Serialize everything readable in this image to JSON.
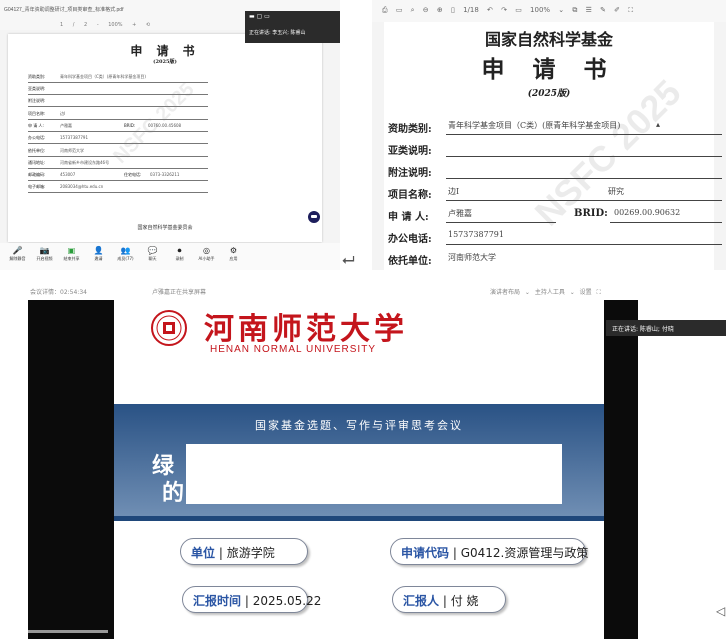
{
  "top_left": {
    "file_name": "G04127_青年资助调整研讨_项目类审查_标准格式.pdf",
    "toolbar_text": "1 / 2  - 100% +  ⟲",
    "doc_title": "申 请 书",
    "doc_year": "(2025版)",
    "rows": [
      {
        "label": "资助类别:",
        "value": "青年科学基金项目（C类）(原青年科学基金项目)"
      },
      {
        "label": "亚类说明:",
        "value": ""
      },
      {
        "label": "附注说明:",
        "value": ""
      },
      {
        "label": "项目名称:",
        "value": "边I"
      },
      {
        "label": "申 请 人:",
        "value": "卢雅嘉"
      },
      {
        "label": "办公电话:",
        "value": "15737387791"
      },
      {
        "label": "依托单位:",
        "value": "河南师范大学"
      },
      {
        "label": "通讯地址:",
        "value": "河南省新乡市建设东路46号"
      },
      {
        "label": "邮政编码:",
        "value": "453007"
      },
      {
        "label": "电子邮箱:",
        "value": "2083034@htu.edu.cn"
      }
    ],
    "brid_label": "BRID:",
    "brid_value": "00760.00.45608",
    "phone_label": "住宅电话:",
    "phone_value": "0373-3326211",
    "footer": "国家自然科学基金委员会",
    "watermark": "NSFC 2025",
    "speaking_label": "正在讲话: 李玉兴; 陈睿山",
    "bottom_items": [
      {
        "icon": "🎤",
        "label": "解除静音"
      },
      {
        "icon": "📷",
        "label": "开启视频"
      },
      {
        "icon": "▣",
        "label": "结束共享"
      },
      {
        "icon": "👤",
        "label": "邀请"
      },
      {
        "icon": "👥",
        "label": "成员(77)"
      },
      {
        "icon": "💬",
        "label": "聊天"
      },
      {
        "icon": "⏺",
        "label": "录制"
      },
      {
        "icon": "◎",
        "label": "AI小助手"
      },
      {
        "icon": "⚙",
        "label": "应用"
      }
    ]
  },
  "top_right": {
    "toolbar_text": "⎙ ▭ ⌕   ⊖ ⊕ ▯ 1/18 ↶ ↷ ▭ 100% ⌄ ⧉ ☰ ✎ ✐ ⛶",
    "title1": "国家自然科学基金",
    "title2": "申 请 书",
    "year": "(2025版)",
    "watermark": "NSFC 2025",
    "rows": [
      {
        "label": "资助类别:",
        "value": "青年科学基金项目（C类）(原青年科学基金项目)"
      },
      {
        "label": "亚类说明:",
        "value": ""
      },
      {
        "label": "附注说明:",
        "value": ""
      },
      {
        "label": "项目名称:",
        "value": "边I"
      },
      {
        "label": "申 请 人:",
        "value": "卢雅嘉"
      },
      {
        "label": "办公电话:",
        "value": "15737387791"
      },
      {
        "label": "依托单位:",
        "value": "河南师范大学"
      }
    ],
    "project_suffix": "研究",
    "brid_label": "BRID:",
    "brid_value": "00269.00.90632"
  },
  "bottom": {
    "meeting_time": "会议详情：02:54:34",
    "sharing_text": "卢雅嘉正在共享屏幕",
    "top_right_controls": "演讲者布局 ⌄   主持人工具 ⌄   设置   ⛶",
    "speaking_label": "正在讲话: 陈睿山; 付晓",
    "university_cn": "河南师范大学",
    "university_en": "HENAN NORMAL UNIVERSITY",
    "conference_title": "国家基金选题、写作与评审思考会议",
    "big_line1": "绿",
    "big_line2": "的",
    "pills": [
      {
        "key": "单位",
        "value": "旅游学院"
      },
      {
        "key": "申请代码",
        "value": "G0412.资源管理与政策"
      },
      {
        "key": "汇报时间",
        "value": "2025.05.22"
      },
      {
        "key": "汇报人",
        "value": "付 娆"
      }
    ],
    "accent_color": "#c4151c",
    "band_color": "#2f5a8d",
    "key_color": "#2a55a4"
  },
  "icons": {
    "back": "⮠",
    "edge": "◁"
  }
}
